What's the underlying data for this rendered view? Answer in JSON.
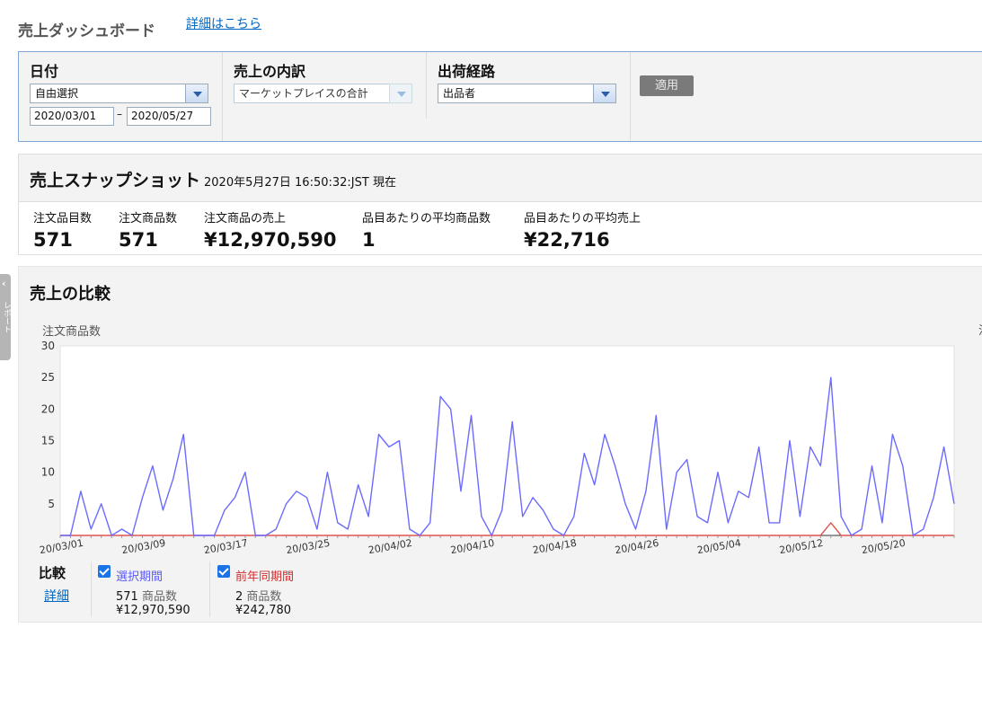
{
  "header": {
    "title": "売上ダッシュボード",
    "detail_link": "詳細はこちら"
  },
  "filters": {
    "date": {
      "label": "日付",
      "mode": "自由選択",
      "from": "2020/03/01",
      "sep": "–",
      "to": "2020/05/27"
    },
    "breakdown": {
      "label": "売上の内訳",
      "value": "マーケットプレイスの合計"
    },
    "channel": {
      "label": "出荷経路",
      "value": "出品者"
    },
    "apply_label": "適用"
  },
  "snapshot": {
    "title": "売上スナップショット",
    "timestamp": "2020年5月27日 16:50:32:JST 現在",
    "metrics": [
      {
        "label": "注文品目数",
        "value": "571"
      },
      {
        "label": "注文商品数",
        "value": "571"
      },
      {
        "label": "注文商品の売上",
        "value": "¥12,970,590"
      },
      {
        "label": "品目あたりの平均商品数",
        "value": "1"
      },
      {
        "label": "品目あたりの平均売上",
        "value": "¥22,716"
      }
    ]
  },
  "side_tab": {
    "label": "レポート"
  },
  "comparison": {
    "title": "売上の比較",
    "legend_label": "比較",
    "detail_link": "詳細",
    "series_meta": [
      {
        "name": "選択期間",
        "units_value": "571",
        "units_suffix": "商品数",
        "sales": "¥12,970,590",
        "color": "#6b6bff"
      },
      {
        "name": "前年同期間",
        "units_value": "2",
        "units_suffix": "商品数",
        "sales": "¥242,780",
        "color": "#e05555"
      }
    ]
  },
  "chart_data": {
    "type": "line",
    "ylabel": "注文商品数",
    "ylim": [
      0,
      30
    ],
    "yticks": [
      5,
      10,
      15,
      20,
      25,
      30
    ],
    "x_tick_labels": [
      "20/03/01",
      "20/03/09",
      "20/03/17",
      "20/03/25",
      "20/04/02",
      "20/04/10",
      "20/04/18",
      "20/04/26",
      "20/05/04",
      "20/05/12",
      "20/05/20"
    ],
    "x_tick_indices": [
      0,
      8,
      16,
      24,
      32,
      40,
      48,
      56,
      64,
      72,
      80
    ],
    "right_axis_clipped": "注",
    "series": [
      {
        "name": "選択期間",
        "color": "#6b6bff",
        "values": [
          0,
          0,
          7,
          1,
          5,
          0,
          1,
          0,
          6,
          11,
          4,
          9,
          16,
          0,
          0,
          0,
          4,
          6,
          10,
          0,
          0,
          1,
          5,
          7,
          6,
          1,
          10,
          2,
          1,
          8,
          3,
          16,
          14,
          15,
          1,
          0,
          2,
          22,
          20,
          7,
          19,
          3,
          0,
          4,
          18,
          3,
          6,
          4,
          1,
          0,
          3,
          13,
          8,
          16,
          11,
          5,
          1,
          7,
          19,
          1,
          10,
          12,
          3,
          2,
          10,
          2,
          7,
          6,
          14,
          2,
          2,
          15,
          3,
          14,
          11,
          25,
          3,
          0,
          1,
          11,
          2,
          16,
          11,
          0,
          1,
          6,
          14,
          5
        ]
      },
      {
        "name": "前年同期間",
        "color": "#e05555",
        "values": [
          0,
          0,
          0,
          0,
          0,
          0,
          0,
          0,
          0,
          0,
          0,
          0,
          0,
          0,
          0,
          0,
          0,
          0,
          0,
          0,
          0,
          0,
          0,
          0,
          0,
          0,
          0,
          0,
          0,
          0,
          0,
          0,
          0,
          0,
          0,
          0,
          0,
          0,
          0,
          0,
          0,
          0,
          0,
          0,
          0,
          0,
          0,
          0,
          0,
          0,
          0,
          0,
          0,
          0,
          0,
          0,
          0,
          0,
          0,
          0,
          0,
          0,
          0,
          0,
          0,
          0,
          0,
          0,
          0,
          0,
          0,
          0,
          0,
          0,
          0,
          2,
          0,
          0,
          0,
          0,
          0,
          0,
          0,
          0,
          0,
          0,
          0,
          0
        ]
      }
    ]
  }
}
